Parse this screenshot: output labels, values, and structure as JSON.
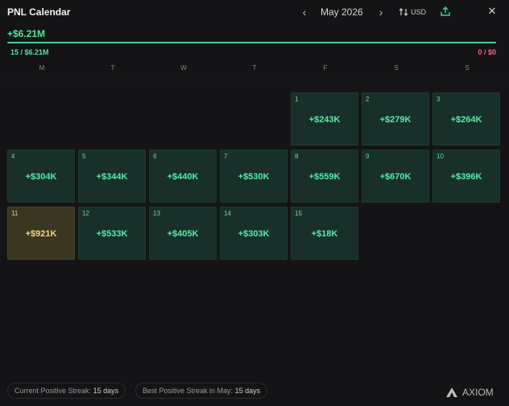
{
  "header": {
    "title": "PNL Calendar",
    "month": "May 2026",
    "currency": "USD",
    "prev_glyph": "‹",
    "next_glyph": "›",
    "close_glyph": "✕"
  },
  "summary": {
    "total": "+$6.21M",
    "positive": "15 / $6.21M",
    "negative": "0 / $0",
    "positive_color": "#4ee6a0",
    "negative_color": "#ff5d86"
  },
  "weekdays": [
    "M",
    "T",
    "W",
    "T",
    "F",
    "S",
    "S"
  ],
  "days": [
    {
      "day": "1",
      "value": "+$243K"
    },
    {
      "day": "2",
      "value": "+$279K"
    },
    {
      "day": "3",
      "value": "+$264K"
    },
    {
      "day": "4",
      "value": "+$304K"
    },
    {
      "day": "5",
      "value": "+$344K"
    },
    {
      "day": "6",
      "value": "+$440K"
    },
    {
      "day": "7",
      "value": "+$530K"
    },
    {
      "day": "8",
      "value": "+$559K"
    },
    {
      "day": "9",
      "value": "+$670K"
    },
    {
      "day": "10",
      "value": "+$396K"
    },
    {
      "day": "11",
      "value": "+$921K",
      "best": true
    },
    {
      "day": "12",
      "value": "+$533K"
    },
    {
      "day": "13",
      "value": "+$405K"
    },
    {
      "day": "14",
      "value": "+$303K"
    },
    {
      "day": "15",
      "value": "+$18K"
    }
  ],
  "footer": {
    "current_streak_label": "Current Positive Streak:",
    "current_streak_value": "15 days",
    "best_streak_label": "Best Positive Streak in May:",
    "best_streak_value": "15 days",
    "brand": "AXIOM"
  },
  "icons": {
    "prev": "chevron-left-icon",
    "next": "chevron-right-icon",
    "currency": "swap-vertical-icon",
    "share": "share-upload-icon",
    "close": "close-icon",
    "brand": "axiom-logo-icon"
  }
}
